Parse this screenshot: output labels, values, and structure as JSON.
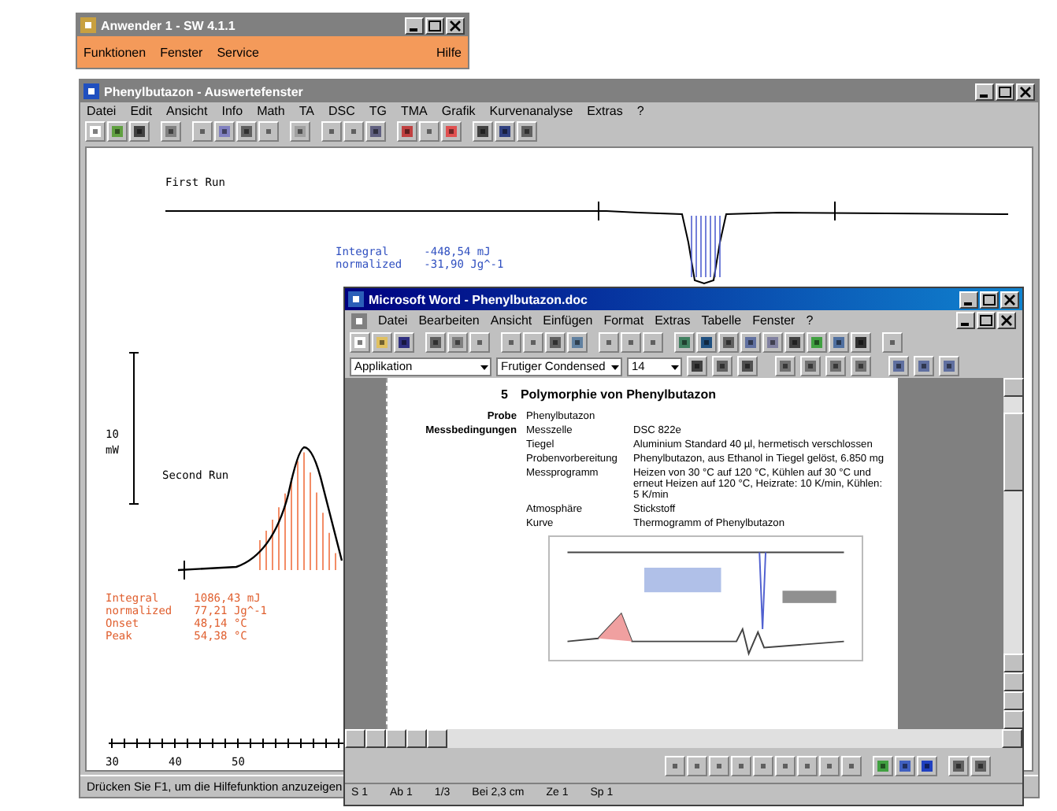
{
  "launcher_window": {
    "title": "Anwender 1 - SW 4.1.1",
    "menu": [
      "Funktionen",
      "Fenster",
      "Service"
    ],
    "help_menu": "Hilfe"
  },
  "dsc_window": {
    "title": "Phenylbutazon - Auswertefenster",
    "menu": [
      "Datei",
      "Edit",
      "Ansicht",
      "Info",
      "Math",
      "TA",
      "DSC",
      "TG",
      "TMA",
      "Grafik",
      "Kurvenanalyse",
      "Extras",
      "?"
    ],
    "plot": {
      "first_run_label": "First Run",
      "first_run_results": [
        {
          "label": "Integral",
          "value": "-448,54 mJ"
        },
        {
          "label": "normalized",
          "value": "-31,90 Jg^-1"
        }
      ],
      "scale_value": "10",
      "scale_unit": "mW",
      "second_run_label": "Second Run",
      "second_run_results": [
        {
          "label": "Integral",
          "value": "1086,43 mJ"
        },
        {
          "label": "normalized",
          "value": "77,21 Jg^-1"
        },
        {
          "label": "Onset",
          "value": "48,14 °C"
        },
        {
          "label": "Peak",
          "value": "54,38 °C"
        }
      ],
      "x_ticks": [
        "30",
        "40",
        "50"
      ]
    },
    "status_bar": "Drücken Sie F1, um die Hilfefunktion anzuzeigen"
  },
  "word_window": {
    "title": "Microsoft Word - Phenylbutazon.doc",
    "menu": [
      "Datei",
      "Bearbeiten",
      "Ansicht",
      "Einfügen",
      "Format",
      "Extras",
      "Tabelle",
      "Fenster",
      "?"
    ],
    "style": "Applikation",
    "font": "Frutiger Condensed",
    "size": "14",
    "document": {
      "heading_number": "5",
      "heading": "Polymorphie von Phenylbutazon",
      "rows": [
        {
          "label": "Probe",
          "key": "Phenylbutazon"
        },
        {
          "label": "Messbedingungen",
          "key": "Messzelle",
          "value": "DSC 822e"
        },
        {
          "key": "Tiegel",
          "value": "Aluminium Standard 40 µl, hermetisch verschlossen"
        },
        {
          "key": "Probenvorbereitung",
          "value": "Phenylbutazon, aus Ethanol in Tiegel gelöst, 6.850 mg"
        },
        {
          "key": "Messprogramm",
          "value": "Heizen von 30 °C auf 120 °C, Kühlen auf 30 °C und erneut Heizen auf 120 °C, Heizrate: 10 K/min, Kühlen: 5 K/min"
        },
        {
          "key": "Atmosphäre",
          "value": "Stickstoff"
        },
        {
          "key": "Kurve",
          "value": "Thermogramm of Phenylbutazon"
        }
      ]
    },
    "status_bar": [
      "S 1",
      "Ab 1",
      "1/3",
      "Bei 2,3 cm",
      "Ze 1",
      "Sp 1"
    ]
  }
}
